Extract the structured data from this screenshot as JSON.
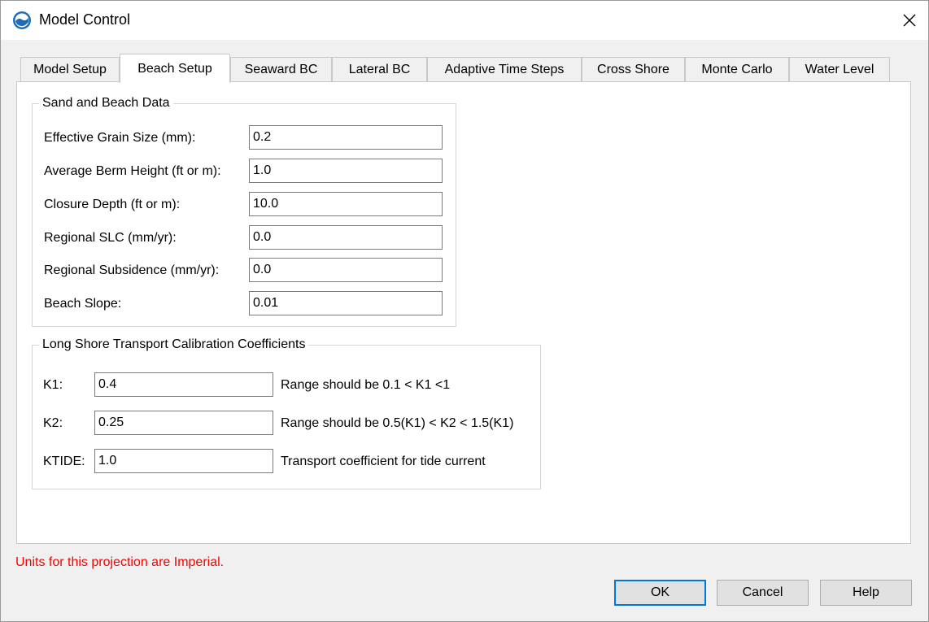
{
  "window": {
    "title": "Model Control"
  },
  "tabs": [
    {
      "label": "Model Setup",
      "active": false
    },
    {
      "label": "Beach Setup",
      "active": true
    },
    {
      "label": "Seaward BC",
      "active": false
    },
    {
      "label": "Lateral BC",
      "active": false
    },
    {
      "label": "Adaptive Time Steps",
      "active": false
    },
    {
      "label": "Cross Shore",
      "active": false
    },
    {
      "label": "Monte Carlo",
      "active": false
    },
    {
      "label": "Water Level",
      "active": false
    }
  ],
  "sand_beach": {
    "title": "Sand and Beach Data",
    "fields": [
      {
        "label": "Effective Grain Size (mm):",
        "value": "0.2"
      },
      {
        "label": "Average Berm Height (ft or m):",
        "value": "1.0"
      },
      {
        "label": "Closure Depth (ft or m):",
        "value": "10.0"
      },
      {
        "label": "Regional SLC (mm/yr):",
        "value": "0.0"
      },
      {
        "label": "Regional Subsidence (mm/yr):",
        "value": "0.0"
      },
      {
        "label": "Beach Slope:",
        "value": "0.01"
      }
    ]
  },
  "longshore": {
    "title": "Long Shore Transport Calibration Coefficients",
    "fields": [
      {
        "label": "K1:",
        "value": "0.4",
        "hint": "Range should be 0.1 < K1 <1"
      },
      {
        "label": "K2:",
        "value": "0.25",
        "hint": "Range should be 0.5(K1) < K2 < 1.5(K1)"
      },
      {
        "label": "KTIDE:",
        "value": "1.0",
        "hint": "Transport coefficient for tide current"
      }
    ]
  },
  "status": {
    "units_message": "Units for this projection are Imperial."
  },
  "buttons": {
    "ok": "OK",
    "cancel": "Cancel",
    "help": "Help"
  },
  "colors": {
    "warning_text": "#ff0000",
    "default_button_border": "#0078d7",
    "app_icon": "#1e6db4"
  }
}
